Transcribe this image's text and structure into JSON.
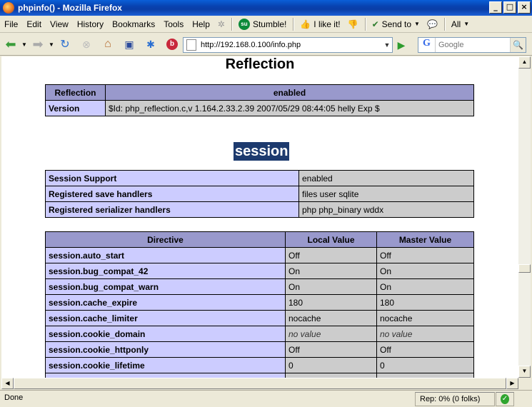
{
  "window": {
    "title": "phpinfo() - Mozilla Firefox"
  },
  "menu": {
    "items": [
      "File",
      "Edit",
      "View",
      "History",
      "Bookmarks",
      "Tools",
      "Help"
    ],
    "stumble_label": "Stumble!",
    "like_label": "I like it!",
    "send_label": "Send to",
    "all_label": "All"
  },
  "nav": {
    "url": "http://192.168.0.100/info.php",
    "search_placeholder": "Google"
  },
  "page": {
    "reflection_heading": "Reflection",
    "reflection_table": {
      "header": [
        "Reflection",
        "enabled"
      ],
      "rows": [
        [
          "Version",
          "$Id: php_reflection.c,v 1.164.2.33.2.39 2007/05/29 08:44:05 helly Exp $"
        ]
      ]
    },
    "session_heading": "session",
    "session_info": [
      [
        "Session Support",
        "enabled"
      ],
      [
        "Registered save handlers",
        "files user sqlite"
      ],
      [
        "Registered serializer handlers",
        "php php_binary wddx"
      ]
    ],
    "directive_table": {
      "header": [
        "Directive",
        "Local Value",
        "Master Value"
      ],
      "rows": [
        [
          "session.auto_start",
          "Off",
          "Off"
        ],
        [
          "session.bug_compat_42",
          "On",
          "On"
        ],
        [
          "session.bug_compat_warn",
          "On",
          "On"
        ],
        [
          "session.cache_expire",
          "180",
          "180"
        ],
        [
          "session.cache_limiter",
          "nocache",
          "nocache"
        ],
        [
          "session.cookie_domain",
          "no value",
          "no value"
        ],
        [
          "session.cookie_httponly",
          "Off",
          "Off"
        ],
        [
          "session.cookie_lifetime",
          "0",
          "0"
        ]
      ]
    }
  },
  "status": {
    "text": "Done",
    "rep": "Rep: 0% (0 folks)"
  }
}
